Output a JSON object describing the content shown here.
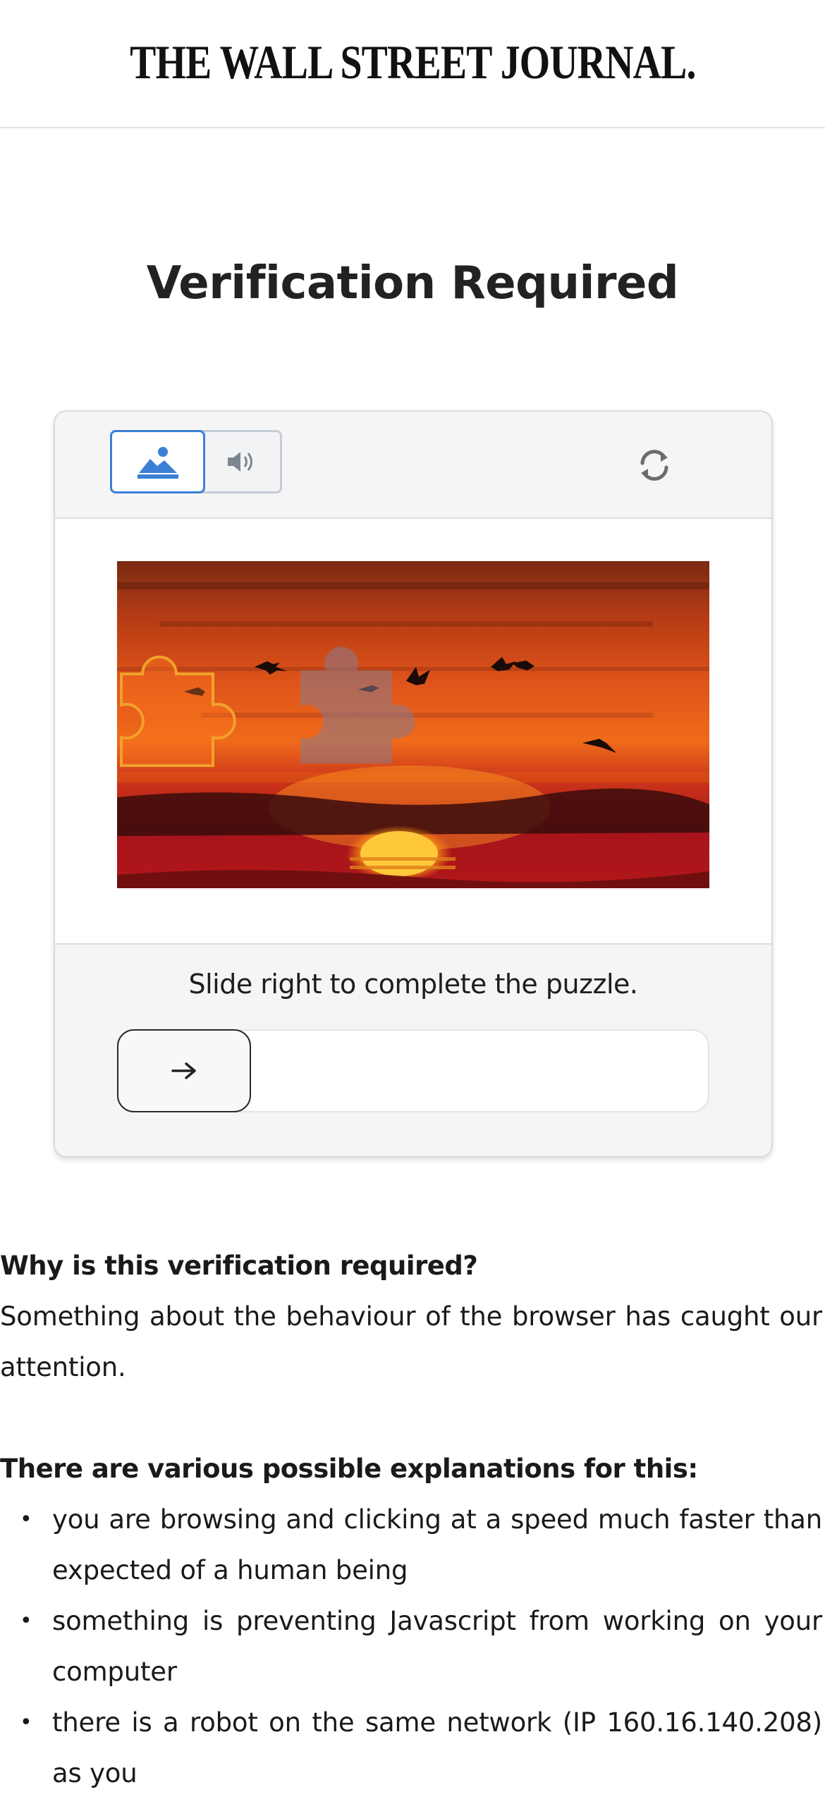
{
  "header": {
    "logo_text": "THE WALL STREET JOURNAL."
  },
  "page": {
    "title": "Verification Required"
  },
  "captcha": {
    "modes": [
      {
        "name": "image",
        "icon": "image-icon",
        "selected": true
      },
      {
        "name": "audio",
        "icon": "speaker-icon",
        "selected": false
      }
    ],
    "refresh_icon": "refresh-icon",
    "instruction": "Slide right to complete the puzzle.",
    "slider_icon": "arrow-right-icon",
    "slider_progress": 0,
    "colors": {
      "accent": "#3b7fd6",
      "puzzle_outline": "#f2a12a"
    }
  },
  "explanation": {
    "why_heading": "Why is this verification required?",
    "why_text": "Something about the behaviour of the browser has caught our attention.",
    "reasons_heading": "There are various possible explanations for this:",
    "reasons": [
      "you are browsing and clicking at a speed much faster than expected of a human being",
      "something is preventing Javascript from working on your computer",
      "there is a robot on the same network (IP 160.16.140.208) as you"
    ]
  }
}
